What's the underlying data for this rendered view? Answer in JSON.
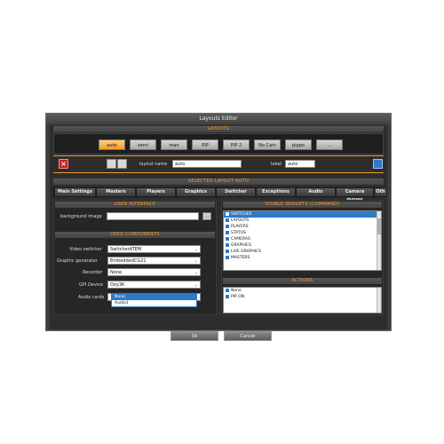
{
  "window": {
    "title": "Layouts Editor"
  },
  "layouts": {
    "header": "LAYOUTS",
    "buttons": [
      "auto",
      "semi",
      "man",
      "PIP",
      "PIP 2",
      "No Cam",
      "pippo",
      "..."
    ],
    "active": "auto"
  },
  "editor": {
    "layout_name_label": "layout name",
    "layout_name_value": "auto",
    "label_label": "label",
    "label_value": "auto"
  },
  "selected": {
    "header": "SELECTED LAYOUT AUTO",
    "tabs": [
      "Main Settings",
      "Masters",
      "Players",
      "Graphics",
      "Switcher",
      "Exceptions",
      "Audio",
      "Camera moves",
      "Oth"
    ]
  },
  "user_interface": {
    "header": "USER INTERFACE",
    "bg_label": "background image",
    "bg_value": "",
    "browse": "..."
  },
  "used_components": {
    "header": "USED COMPONENTS",
    "rows": [
      {
        "label": "Video switcher",
        "value": "SwitcherATEM"
      },
      {
        "label": "Graphic generator",
        "value": "EmbeddedCG21"
      },
      {
        "label": "Recorder",
        "value": "None"
      },
      {
        "label": "GPI Device",
        "value": "Oxy3K"
      },
      {
        "label": "Audio cards",
        "value": ""
      }
    ],
    "audio_options": [
      "None",
      "Audio1"
    ]
  },
  "visible_widgets": {
    "header": "VISIBLE WIDGETS (COMMAND)",
    "items": [
      "SWITCHER",
      "LAYOUTS",
      "PLAYERS",
      "STATUS",
      "CAMERAS",
      "GRAPHICS",
      "LIVE GRAPHICS",
      "MASTERS"
    ],
    "selected": "SWITCHER"
  },
  "actions": {
    "header": "ACTIONS",
    "items": [
      "None",
      "PIP ON"
    ]
  },
  "footer": {
    "ok": "Ok",
    "cancel": "Cancel"
  }
}
